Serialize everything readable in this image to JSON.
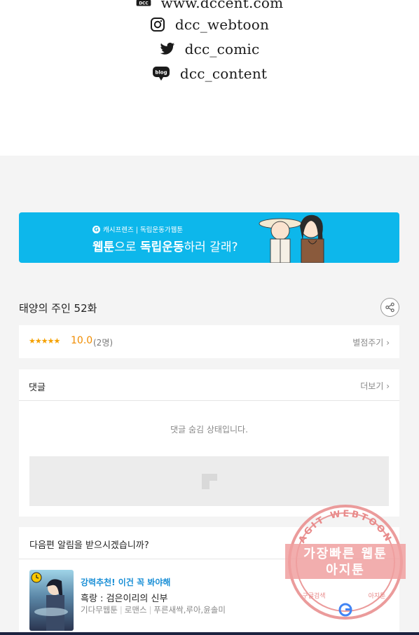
{
  "social": [
    {
      "icon": "website-icon",
      "text": "www.dccent.com"
    },
    {
      "icon": "instagram-icon",
      "text": "dcc_webtoon"
    },
    {
      "icon": "twitter-icon",
      "text": "dcc_comic"
    },
    {
      "icon": "blog-icon",
      "text": "dcc_content"
    }
  ],
  "banner": {
    "small": "캐시프렌즈 | 독립운동가웹툰",
    "title_bold1": "웹툰",
    "title_mid1": "으로 ",
    "title_bold2": "독립운동",
    "title_mid2": "하러 갈래?"
  },
  "episode": {
    "title": "태양의 주인 52화"
  },
  "rating": {
    "stars": "★★★★★",
    "score": "10.0",
    "count": "(2명)",
    "rate_label": "별점주기"
  },
  "comments": {
    "title": "댓글",
    "more": "더보기",
    "hidden_msg": "댓글 숨김 상태입니다."
  },
  "next": {
    "question": "다음편 알림을 받으시겠습니까?",
    "reco_label": "강력추천! 이건 꼭 봐야해",
    "reco_title": "흑랑 : 검은이리의 신부",
    "meta": [
      "기다무웹툰",
      "로맨스",
      "푸른새싹,루아,윤솔미"
    ]
  },
  "watermark": {
    "top_text": "AGIT WEBTOON",
    "line1": "가장빠른 웹툰",
    "line2": "아지툰",
    "bottom_left": "구글검색",
    "bottom_right": "아지툰"
  },
  "colors": {
    "banner_bg": "#0db7eb",
    "accent_orange": "#f08c00",
    "reco_blue": "#1a8fd6",
    "stamp_red": "#e88a8a"
  }
}
